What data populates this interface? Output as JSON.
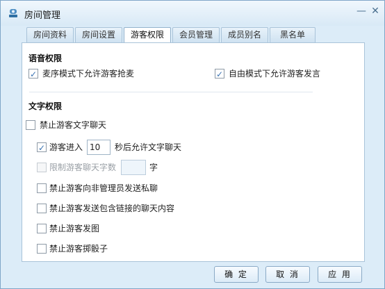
{
  "window": {
    "title": "房间管理",
    "icon": "room-icon",
    "minimize_glyph": "—",
    "close_glyph": "✕"
  },
  "tabs": [
    {
      "label": "房间资料",
      "active": false
    },
    {
      "label": "房间设置",
      "active": false
    },
    {
      "label": "游客权限",
      "active": true
    },
    {
      "label": "会员管理",
      "active": false
    },
    {
      "label": "成员别名",
      "active": false
    },
    {
      "label": "黑名单",
      "active": false
    }
  ],
  "voice_section": {
    "title": "语音权限",
    "options": [
      {
        "label": "麦序模式下允许游客抢麦",
        "checked": true
      },
      {
        "label": "自由模式下允许游客发言",
        "checked": true
      }
    ]
  },
  "text_section": {
    "title": "文字权限",
    "ban_guest_text": {
      "label": "禁止游客文字聊天",
      "checked": false
    },
    "delay_chat": {
      "label_before": "游客进入",
      "value": "10",
      "label_after": "秒后允许文字聊天",
      "checked": true
    },
    "limit_chars": {
      "label": "限制游客聊天字数",
      "value": "",
      "unit": "字",
      "checked": false,
      "disabled": true
    },
    "ban_private_msg": {
      "label": "禁止游客向非管理员发送私聊",
      "checked": false
    },
    "ban_links": {
      "label": "禁止游客发送包含链接的聊天内容",
      "checked": false
    },
    "ban_images": {
      "label": "禁止游客发图",
      "checked": false
    },
    "ban_dice": {
      "label": "禁止游客掷骰子",
      "checked": false
    }
  },
  "buttons": {
    "ok": "确 定",
    "cancel": "取 消",
    "apply": "应 用"
  }
}
